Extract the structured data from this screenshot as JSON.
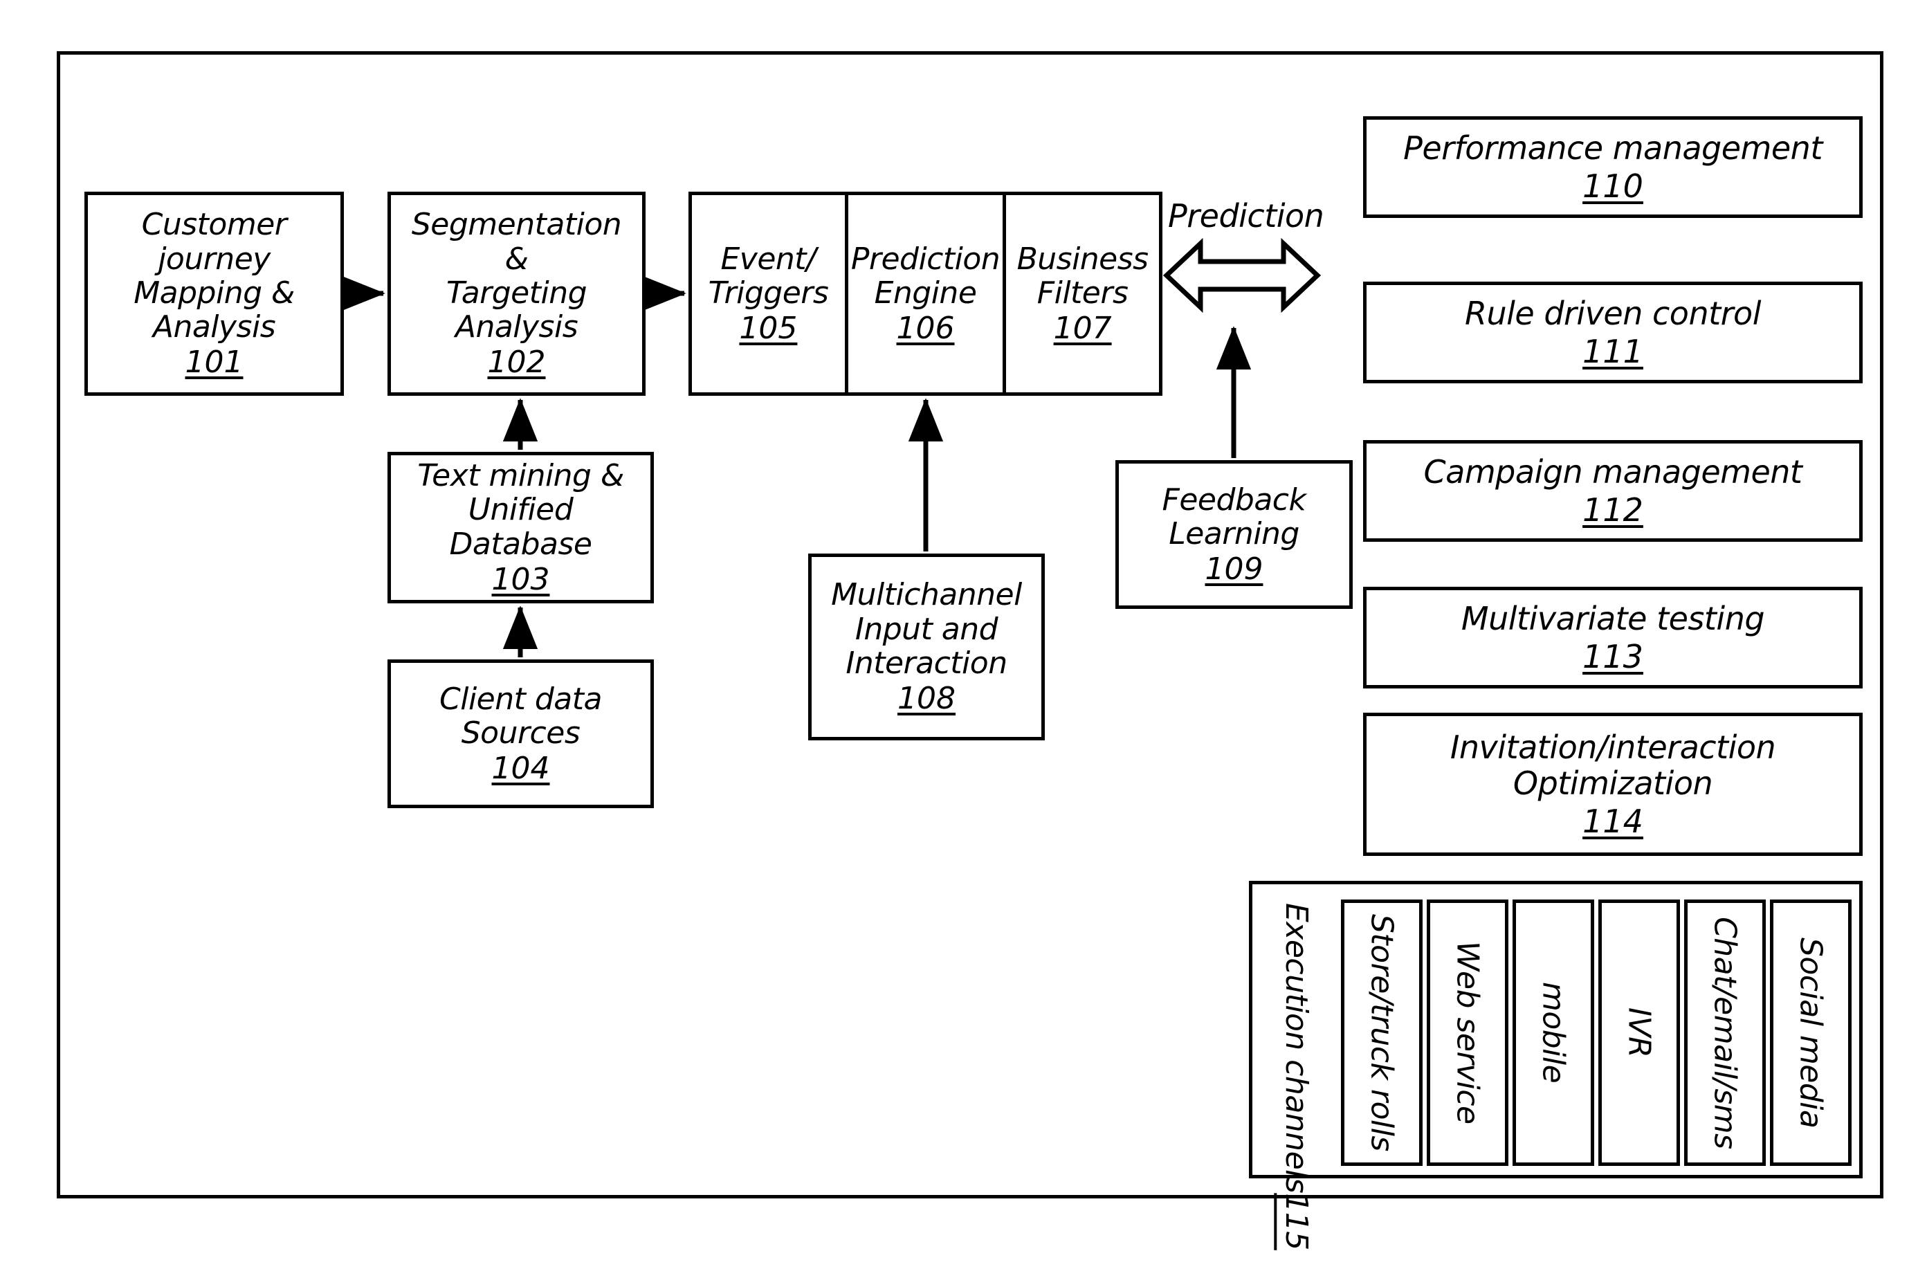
{
  "diagram": {
    "type": "block-diagram",
    "background": "#ffffff",
    "line_color": "#000000"
  },
  "blocks": {
    "b101": {
      "title": "Customer journey\nMapping &\nAnalysis",
      "ref": "101"
    },
    "b102": {
      "title": "Segmentation &\nTargeting\nAnalysis",
      "ref": "102"
    },
    "b103": {
      "title": "Text mining &\nUnified Database",
      "ref": "103"
    },
    "b104": {
      "title": "Client data\nSources",
      "ref": "104"
    },
    "b105": {
      "title": "Event/\nTriggers",
      "ref": "105"
    },
    "b106": {
      "title": "Prediction\nEngine",
      "ref": "106"
    },
    "b107": {
      "title": "Business\nFilters",
      "ref": "107"
    },
    "b108": {
      "title": "Multichannel\nInput and\nInteraction",
      "ref": "108"
    },
    "b109": {
      "title": "Feedback\nLearning",
      "ref": "109"
    }
  },
  "panels": [
    {
      "title": "Performance management",
      "ref": "110"
    },
    {
      "title": "Rule driven control",
      "ref": "111"
    },
    {
      "title": "Campaign management",
      "ref": "112"
    },
    {
      "title": "Multivariate testing",
      "ref": "113"
    },
    {
      "title": "Invitation/interaction\nOptimization",
      "ref": "114"
    }
  ],
  "execution_channels": {
    "label": "Execution channels",
    "ref": "115",
    "channels": [
      "Store/truck rolls",
      "Web service",
      "mobile",
      "IVR",
      "Chat/email/sms",
      "Social media"
    ]
  },
  "annotations": {
    "prediction": "Prediction"
  }
}
